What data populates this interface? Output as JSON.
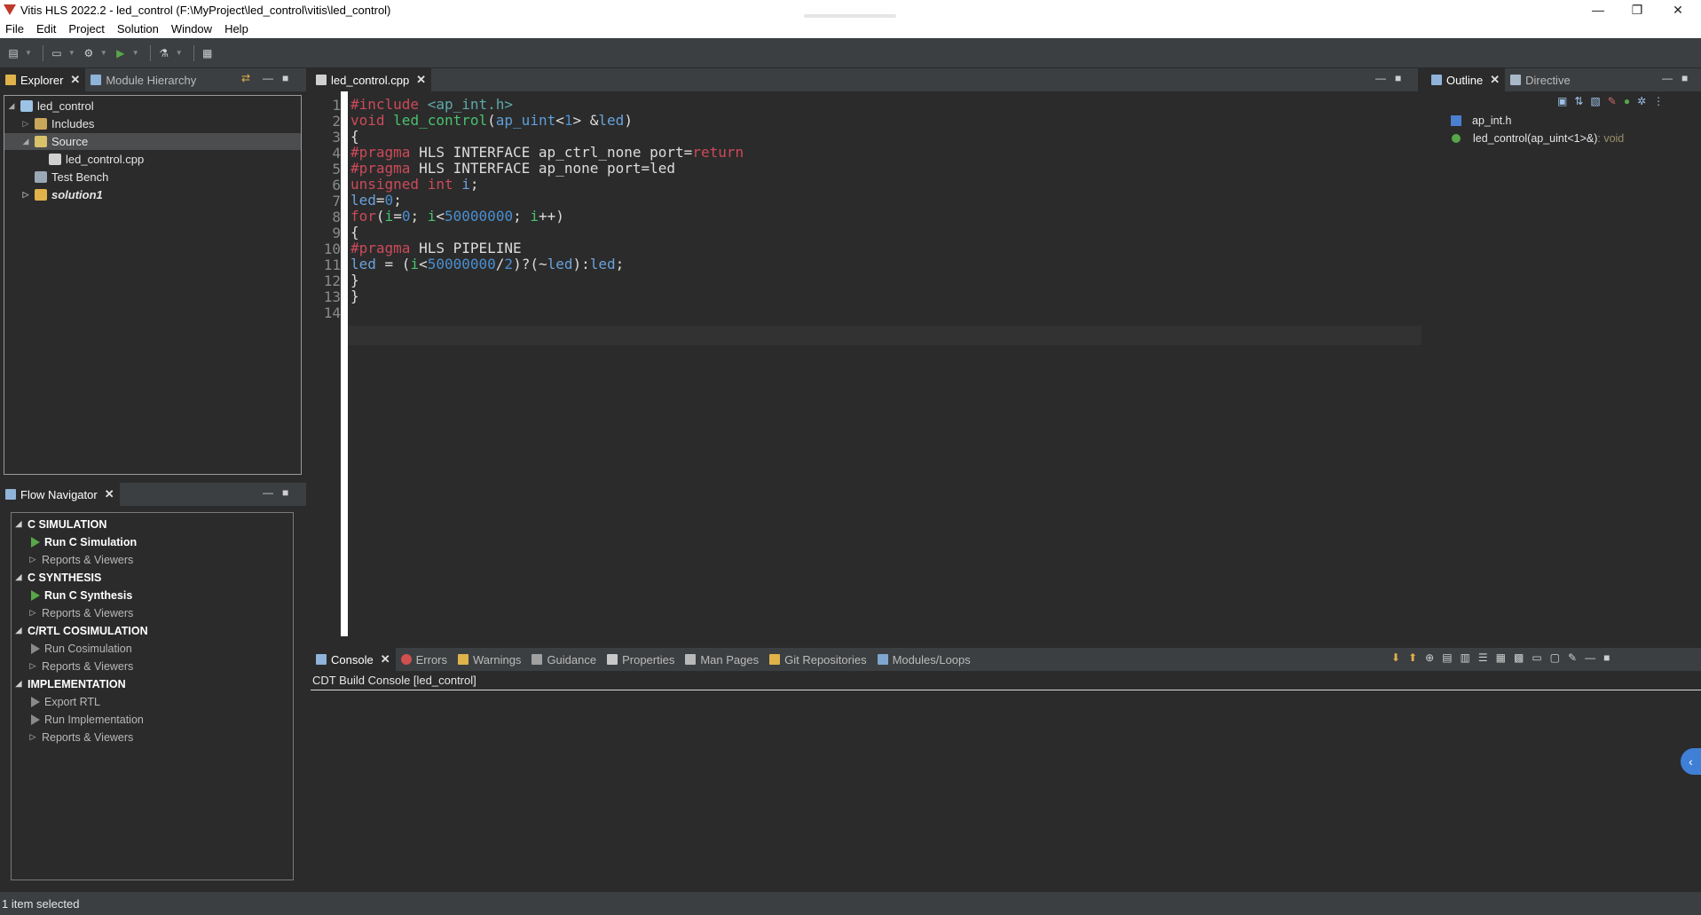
{
  "window": {
    "title": "Vitis HLS 2022.2 - led_control (F:\\MyProject\\led_control\\vitis\\led_control)",
    "controls": {
      "minimize": "—",
      "restore": "❐",
      "close": "✕"
    }
  },
  "menu": [
    "File",
    "Edit",
    "Project",
    "Solution",
    "Window",
    "Help"
  ],
  "explorer": {
    "tabs": [
      {
        "label": "Explorer",
        "active": true
      },
      {
        "label": "Module Hierarchy",
        "active": false
      }
    ],
    "tree": [
      {
        "label": "led_control",
        "icon": "project-icon"
      },
      {
        "label": "Includes",
        "icon": "includes-icon"
      },
      {
        "label": "Source",
        "icon": "source-folder-icon"
      },
      {
        "label": "led_control.cpp",
        "icon": "cpp-file-icon"
      },
      {
        "label": "Test Bench",
        "icon": "testbench-icon"
      },
      {
        "label": "solution1",
        "icon": "solution-folder-icon"
      }
    ]
  },
  "flow": {
    "tab": "Flow Navigator",
    "items": [
      {
        "label": "C SIMULATION",
        "kind": "section"
      },
      {
        "label": "Run C Simulation",
        "kind": "action"
      },
      {
        "label": "Reports & Viewers",
        "kind": "reports"
      },
      {
        "label": "C SYNTHESIS",
        "kind": "section"
      },
      {
        "label": "Run C Synthesis",
        "kind": "action"
      },
      {
        "label": "Reports & Viewers",
        "kind": "reports"
      },
      {
        "label": "C/RTL COSIMULATION",
        "kind": "section"
      },
      {
        "label": "Run Cosimulation",
        "kind": "action-dim"
      },
      {
        "label": "Reports & Viewers",
        "kind": "reports"
      },
      {
        "label": "IMPLEMENTATION",
        "kind": "section"
      },
      {
        "label": "Export RTL",
        "kind": "action-dim"
      },
      {
        "label": "Run Implementation",
        "kind": "action-dim"
      },
      {
        "label": "Reports & Viewers",
        "kind": "reports"
      }
    ]
  },
  "editor": {
    "tab": "led_control.cpp",
    "line_numbers": [
      "1",
      "2",
      "3",
      "4",
      "5",
      "6",
      "7",
      "8",
      "9",
      "10",
      "11",
      "12",
      "13",
      "14"
    ],
    "lines": [
      [
        {
          "t": "#include ",
          "c": "dir"
        },
        {
          "t": "<ap_int.h>",
          "c": "str"
        }
      ],
      [
        {
          "t": "void ",
          "c": "kw"
        },
        {
          "t": "led_control",
          "c": "fn"
        },
        {
          "t": "(",
          "c": "plain"
        },
        {
          "t": "ap_uint",
          "c": "type"
        },
        {
          "t": "<",
          "c": "plain"
        },
        {
          "t": "1",
          "c": "num"
        },
        {
          "t": "> &",
          "c": "plain"
        },
        {
          "t": "led",
          "c": "var"
        },
        {
          "t": ")",
          "c": "plain"
        }
      ],
      [
        {
          "t": "{",
          "c": "plain"
        }
      ],
      [
        {
          "t": "#pragma ",
          "c": "dir"
        },
        {
          "t": "HLS INTERFACE ap_ctrl_none port=",
          "c": "plain"
        },
        {
          "t": "return",
          "c": "kw"
        }
      ],
      [
        {
          "t": "#pragma ",
          "c": "dir"
        },
        {
          "t": "HLS INTERFACE ap_none port=led",
          "c": "plain"
        }
      ],
      [
        {
          "t": "unsigned int ",
          "c": "kw"
        },
        {
          "t": "i",
          "c": "var"
        },
        {
          "t": ";",
          "c": "plain"
        }
      ],
      [
        {
          "t": "led",
          "c": "var"
        },
        {
          "t": "=",
          "c": "plain"
        },
        {
          "t": "0",
          "c": "num"
        },
        {
          "t": ";",
          "c": "plain"
        }
      ],
      [
        {
          "t": "for",
          "c": "kw"
        },
        {
          "t": "(",
          "c": "plain"
        },
        {
          "t": "i",
          "c": "fn"
        },
        {
          "t": "=",
          "c": "plain"
        },
        {
          "t": "0",
          "c": "num"
        },
        {
          "t": "; ",
          "c": "plain"
        },
        {
          "t": "i",
          "c": "fn"
        },
        {
          "t": "<",
          "c": "plain"
        },
        {
          "t": "50000000",
          "c": "num"
        },
        {
          "t": "; ",
          "c": "plain"
        },
        {
          "t": "i",
          "c": "fn"
        },
        {
          "t": "++)",
          "c": "plain"
        }
      ],
      [
        {
          "t": "{",
          "c": "plain"
        }
      ],
      [
        {
          "t": "#pragma ",
          "c": "dir"
        },
        {
          "t": "HLS PIPELINE",
          "c": "plain"
        }
      ],
      [
        {
          "t": "led",
          "c": "var"
        },
        {
          "t": " = (",
          "c": "plain"
        },
        {
          "t": "i",
          "c": "fn"
        },
        {
          "t": "<",
          "c": "plain"
        },
        {
          "t": "50000000",
          "c": "num"
        },
        {
          "t": "/",
          "c": "plain"
        },
        {
          "t": "2",
          "c": "num"
        },
        {
          "t": ")?(~",
          "c": "plain"
        },
        {
          "t": "led",
          "c": "var"
        },
        {
          "t": "):",
          "c": "plain"
        },
        {
          "t": "led",
          "c": "var"
        },
        {
          "t": ";",
          "c": "plain"
        }
      ],
      [
        {
          "t": "}",
          "c": "plain"
        }
      ],
      [
        {
          "t": "}",
          "c": "plain"
        }
      ],
      []
    ]
  },
  "outline": {
    "tabs": [
      {
        "label": "Outline",
        "active": true
      },
      {
        "label": "Directive",
        "active": false
      }
    ],
    "items": [
      {
        "label": "ap_int.h",
        "suffix": "",
        "icon": "include-icon"
      },
      {
        "label": "led_control(ap_uint<1>&)",
        "suffix": " : void",
        "icon": "function-icon"
      }
    ]
  },
  "console": {
    "tabs": [
      "Console",
      "Errors",
      "Warnings",
      "Guidance",
      "Properties",
      "Man Pages",
      "Git Repositories",
      "Modules/Loops"
    ],
    "header": "CDT Build Console [led_control]"
  },
  "status": {
    "text": "1 item selected"
  },
  "colors": {
    "accent": "#3f7fd6",
    "keyword": "#cc4a5a",
    "function": "#49c16f",
    "number": "#4a8fd1"
  }
}
